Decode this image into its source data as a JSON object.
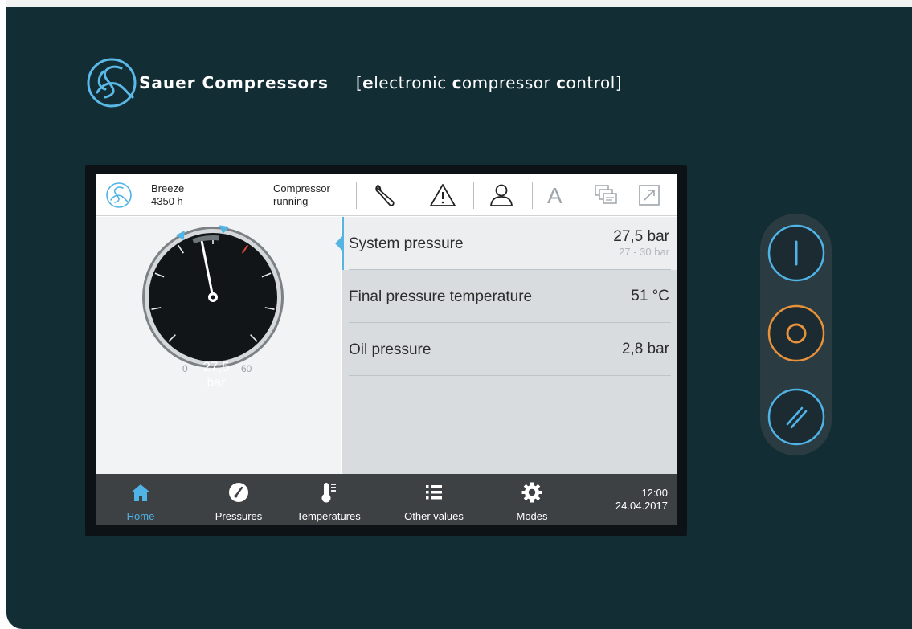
{
  "brand": {
    "name": "Sauer Compressors",
    "tagline": {
      "open": "[",
      "p1_bold": "e",
      "p1_rest": "lectronic ",
      "p2_bold": "c",
      "p2_rest": "ompressor ",
      "p3_bold": "c",
      "p3_rest": "ontrol",
      "close": "]"
    },
    "logo_icon": "sauer-logo-icon"
  },
  "topbar": {
    "mode_line1": "Breeze",
    "mode_line2": "4350 h",
    "status_line1": "Compressor",
    "status_line2": "running",
    "icons": [
      "wrench-icon",
      "warning-icon",
      "user-icon",
      "font-icon",
      "language-icon",
      "expand-icon"
    ],
    "font_glyph": "A"
  },
  "gauge": {
    "value": "27,5",
    "unit": "bar",
    "min": "0",
    "max": "60",
    "current": 27.5,
    "range": [
      0,
      60
    ],
    "setpoint_low": 27,
    "setpoint_high": 30,
    "accent": "#4fb3e6",
    "alarm": "#d64a3b"
  },
  "values": {
    "rows": [
      {
        "label": "System pressure",
        "value": "27,5 bar",
        "range": "27 - 30 bar"
      },
      {
        "label": "Final pressure temperature",
        "value": "51 °C"
      },
      {
        "label": "Oil pressure",
        "value": "2,8 bar"
      }
    ]
  },
  "nav": {
    "items": [
      {
        "label": "Home",
        "icon": "home-icon"
      },
      {
        "label": "Pressures",
        "icon": "gauge-icon"
      },
      {
        "label": "Temperatures",
        "icon": "thermometer-icon"
      },
      {
        "label": "Other values",
        "icon": "list-icon"
      },
      {
        "label": "Modes",
        "icon": "gear-icon"
      }
    ],
    "time": "12:00",
    "date": "24.04.2017"
  },
  "hardware_buttons": [
    {
      "name": "start-button",
      "icon": "start-icon",
      "color": "#4fb3e6"
    },
    {
      "name": "stop-button",
      "icon": "stop-icon",
      "color": "#e8913b"
    },
    {
      "name": "emergency-button",
      "icon": "reset-icon",
      "color": "#4fb3e6"
    }
  ],
  "colors": {
    "panel": "#132d34",
    "accent": "#4fb3e6",
    "orange": "#e8913b",
    "navbar": "#3d4144"
  }
}
